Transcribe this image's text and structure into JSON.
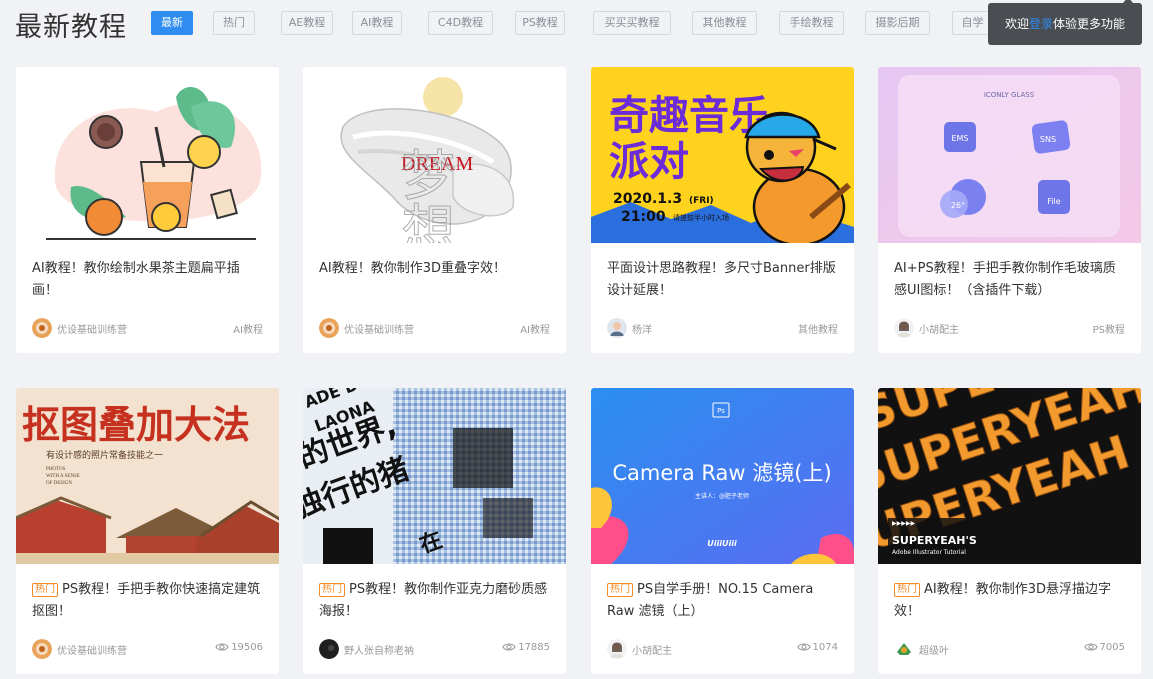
{
  "header": {
    "title": "最新教程",
    "tabs": [
      {
        "label": "最新",
        "active": true
      },
      {
        "label": "热门"
      },
      {
        "label": "AE教程"
      },
      {
        "label": "AI教程"
      },
      {
        "label": "C4D教程"
      },
      {
        "label": "PS教程"
      },
      {
        "label": "买买买教程"
      },
      {
        "label": "其他教程"
      },
      {
        "label": "手绘教程"
      },
      {
        "label": "摄影后期"
      },
      {
        "label": "自学"
      }
    ],
    "login_tip": {
      "prefix": "欢迎",
      "link": "登录",
      "suffix": "体验更多功能"
    }
  },
  "hot_label": "热门",
  "cards": [
    {
      "title": "AI教程！教你绘制水果茶主题扁平插画！",
      "author": "优设基础训练营",
      "category": "AI教程"
    },
    {
      "title": "AI教程！教你制作3D重叠字效！",
      "author": "优设基础训练营",
      "category": "AI教程",
      "thumb_text": {
        "word": "DREAM",
        "chars": "梦想"
      }
    },
    {
      "title": "平面设计思路教程！多尺寸Banner排版设计延展！",
      "author": "杨洋",
      "category": "其他教程",
      "thumb_text": {
        "line1": "奇趣音乐",
        "line2": "派对",
        "date": "2020.1.3",
        "day": "(FRI)",
        "time": "21:00",
        "note": "请提前半小时入场"
      }
    },
    {
      "title": "AI+PS教程！手把手教你制作毛玻璃质感UI图标！（含插件下载）",
      "author": "小胡配主",
      "category": "PS教程",
      "thumb_text": {
        "brand": "ICONLY GLASS",
        "icons": [
          "EMS",
          "SNS",
          "26°",
          "File"
        ]
      }
    },
    {
      "title": "PS教程！手把手教你快速搞定建筑抠图！",
      "author": "优设基础训练营",
      "views": "19506",
      "hot": true,
      "thumb_text": {
        "headline": "抠图叠加大法",
        "sub": "有设计感的照片常备技能之一",
        "en1": "PHOTOS",
        "en2": "WITH A SENSE",
        "en3": "OF DESIGN"
      }
    },
    {
      "title": "PS教程！教你制作亚克力磨砂质感海报！",
      "author": "野人张自称老衲",
      "views": "17885",
      "hot": true,
      "thumb_text": {
        "a": "ADE D",
        "b": "LAONA",
        "c": "的世界,",
        "d": "独行的猪",
        "e": "在"
      }
    },
    {
      "title": "PS自学手册！NO.15 Camera Raw 滤镜（上）",
      "author": "小胡配主",
      "views": "1074",
      "hot": true,
      "thumb_text": {
        "ps": "Ps",
        "headline": "Camera Raw 滤镜(上)",
        "host": "主讲人：@肥子老师",
        "logo": "UiiiUiii"
      }
    },
    {
      "title": "AI教程！教你制作3D悬浮描边字效！",
      "author": "超级叶",
      "views": "7005",
      "hot": true,
      "thumb_text": {
        "word": "SUPERYEAH",
        "tag": "SUPERYEAH'S",
        "sub": "Adobe Illustrator Tutorial"
      }
    }
  ]
}
